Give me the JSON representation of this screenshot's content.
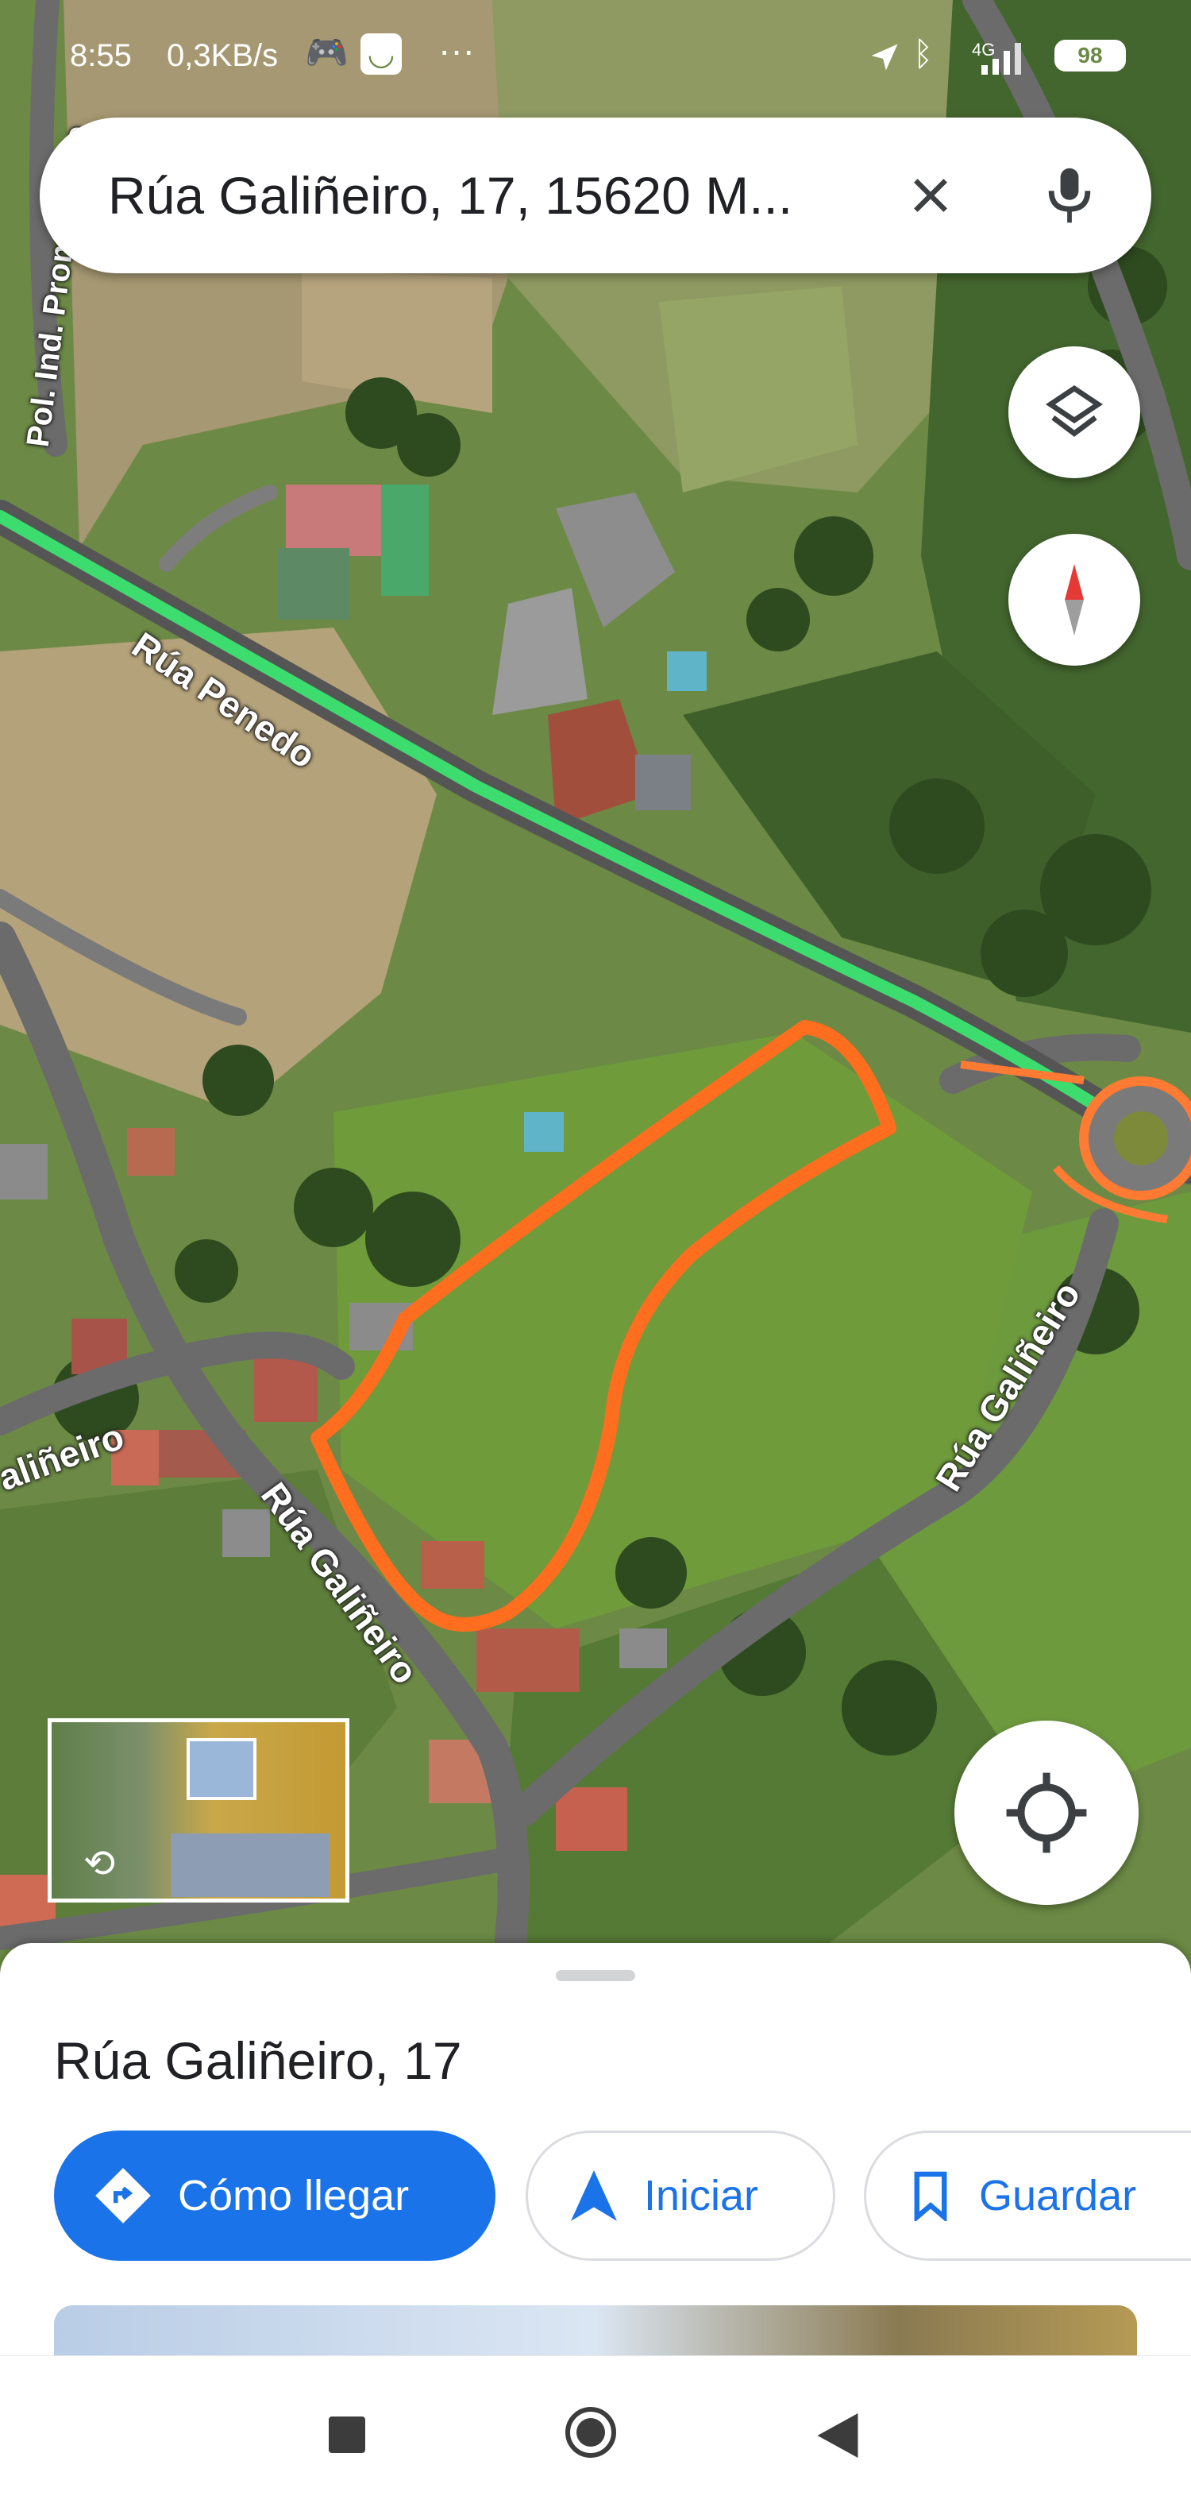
{
  "status_bar": {
    "time": "8:55",
    "speed": "0,3KB/s",
    "more": "···",
    "network": "4G",
    "battery": "98",
    "icons": [
      "game-controller-icon",
      "smile-app-icon",
      "location-arrow-icon",
      "bluetooth-icon",
      "signal-icon",
      "battery-icon"
    ]
  },
  "search": {
    "query": "Rúa Galiñeiro, 17, 15620 M...",
    "clear_icon": "close-icon",
    "voice_icon": "mic-icon"
  },
  "map": {
    "labels": {
      "pol_ind": "Pol. Ind. Promontoiro",
      "penedo": "Rúa Penedo",
      "galineiro_left": "aliñeiro",
      "galineiro_center": "Rúa Galiñeiro",
      "galineiro_right": "Rúa Galiñeiro"
    },
    "controls": [
      "layers-icon",
      "compass-icon",
      "my-location-icon"
    ],
    "highlight_color": "#ff6d1f",
    "route_color": "#3ddc6e",
    "street_view_icon": "street-view-360-icon"
  },
  "place": {
    "title": "Rúa Galiñeiro, 17",
    "actions": {
      "directions": "Cómo llegar",
      "start": "Iniciar",
      "save": "Guardar"
    },
    "accent": "#1a73e8"
  },
  "nav_bar": {
    "buttons": [
      "recents-square-icon",
      "home-circle-icon",
      "back-triangle-icon"
    ]
  }
}
